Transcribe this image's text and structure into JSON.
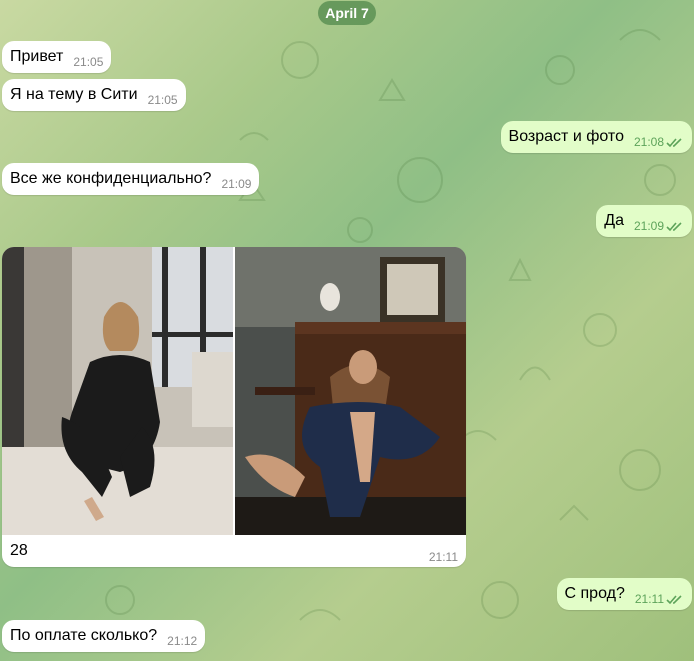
{
  "date_label": "April 7",
  "messages": [
    {
      "text": "Привет",
      "time": "21:05",
      "dir": "in"
    },
    {
      "text": "Я на тему в Сити",
      "time": "21:05",
      "dir": "in"
    },
    {
      "text": "Возраст и фото",
      "time": "21:08",
      "dir": "out",
      "status": "read"
    },
    {
      "text": "Все же конфиденциально?",
      "time": "21:09",
      "dir": "in"
    },
    {
      "text": "Да",
      "time": "21:09",
      "dir": "out",
      "status": "read"
    },
    {
      "text": "С прод?",
      "time": "21:11",
      "dir": "out",
      "status": "read"
    },
    {
      "text": "По оплате сколько?",
      "time": "21:12",
      "dir": "in"
    }
  ],
  "album": {
    "caption": "28",
    "time": "21:11"
  },
  "colors": {
    "incoming_bubble": "#ffffff",
    "outgoing_bubble": "#e2fdc8",
    "read_check": "#5da35a",
    "date_pill": "#5c9154"
  },
  "icons": [
    "double-check-icon"
  ]
}
